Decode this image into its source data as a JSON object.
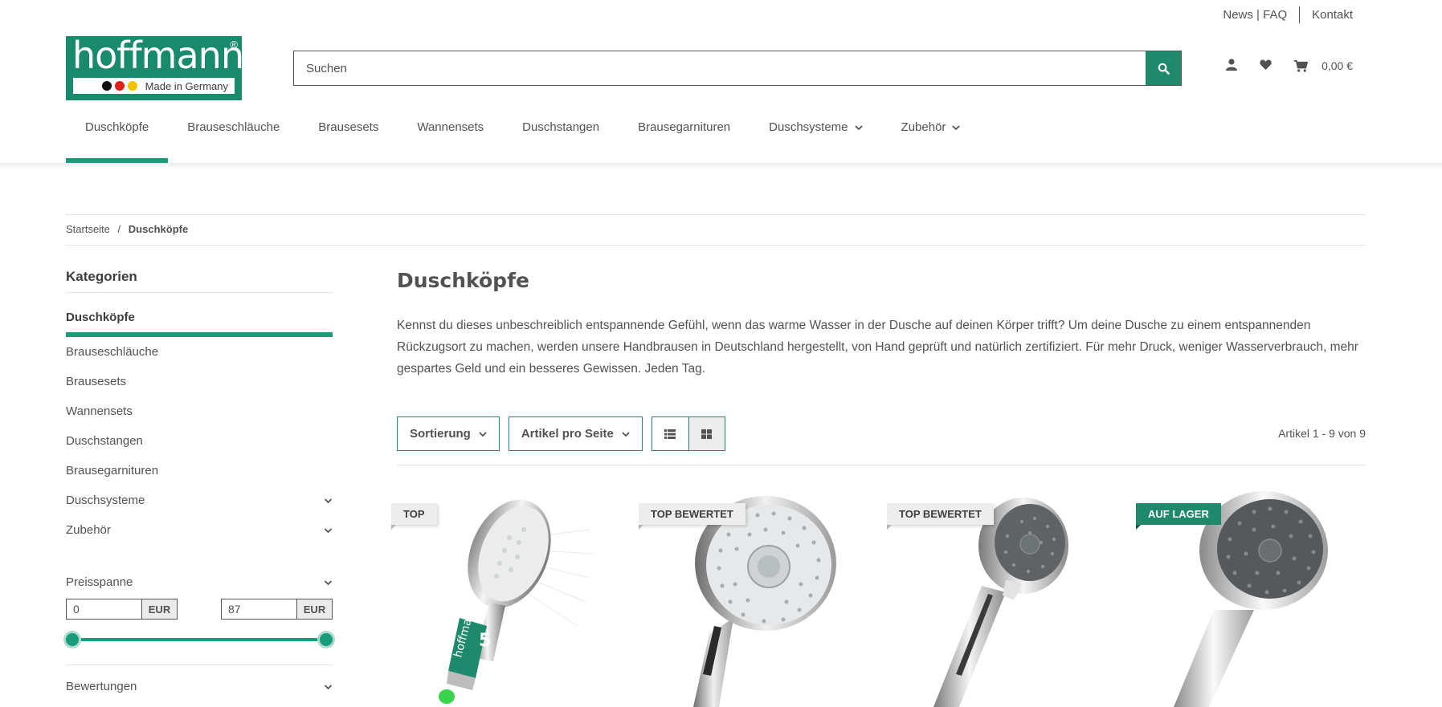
{
  "topbar": {
    "news_faq": "News | FAQ",
    "kontakt": "Kontakt"
  },
  "logo": {
    "word": "hoffmann",
    "reg": "®",
    "tagline": "Made in Germany"
  },
  "search": {
    "placeholder": "Suchen"
  },
  "header": {
    "cart_total": "0,00 €"
  },
  "nav": {
    "items": [
      {
        "label": "Duschköpfe"
      },
      {
        "label": "Brauseschläuche"
      },
      {
        "label": "Brausesets"
      },
      {
        "label": "Wannensets"
      },
      {
        "label": "Duschstangen"
      },
      {
        "label": "Brausegarnituren"
      },
      {
        "label": "Duschsysteme"
      },
      {
        "label": "Zubehör"
      }
    ]
  },
  "breadcrumb": {
    "home": "Startseite",
    "sep": "/",
    "current": "Duschköpfe"
  },
  "sidebar": {
    "title": "Kategorien",
    "items": [
      {
        "label": "Duschköpfe"
      },
      {
        "label": "Brauseschläuche"
      },
      {
        "label": "Brausesets"
      },
      {
        "label": "Wannensets"
      },
      {
        "label": "Duschstangen"
      },
      {
        "label": "Brausegarnituren"
      },
      {
        "label": "Duschsysteme"
      },
      {
        "label": "Zubehör"
      }
    ]
  },
  "price_filter": {
    "title": "Preisspanne",
    "min": "0",
    "max": "87",
    "unit": "EUR"
  },
  "ratings": {
    "title": "Bewertungen"
  },
  "main": {
    "title": "Duschköpfe",
    "description": "Kennst du dieses unbeschreiblich entspannende Gefühl, wenn das warme Wasser in der Dusche auf deinen Körper trifft? Um deine Dusche zu einem entspannenden Rückzugsort zu machen, werden unsere Handbrausen in Deutschland hergestellt, von Hand geprüft und natürlich zertifiziert. Für mehr Druck, weniger Wasserverbrauch, mehr gespartes Geld und ein besseres Gewissen. Jeden Tag."
  },
  "toolbar": {
    "sort": "Sortierung",
    "per_page": "Artikel pro Seite",
    "count": "Artikel 1 - 9 von 9"
  },
  "products": [
    {
      "badge": "TOP",
      "badge_style": "gray"
    },
    {
      "badge": "TOP BEWERTET",
      "badge_style": "gray"
    },
    {
      "badge": "TOP BEWERTET",
      "badge_style": "gray"
    },
    {
      "badge": "AUF LAGER",
      "badge_style": "green"
    }
  ],
  "colors": {
    "brand": "#1e8a6b",
    "accent": "#1a9c7a",
    "text": "#525252"
  }
}
